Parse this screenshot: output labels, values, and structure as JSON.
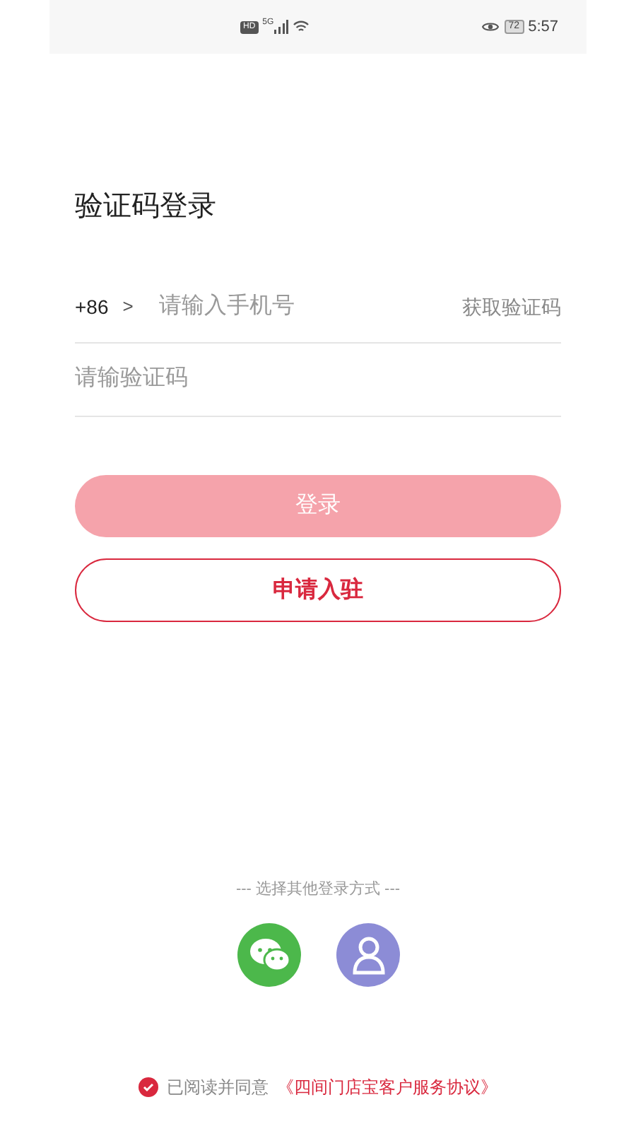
{
  "status_bar": {
    "hd": "HD",
    "network": "5G",
    "battery": "72",
    "time": "5:57"
  },
  "title": "验证码登录",
  "phone": {
    "country_code": "+86",
    "arrow": ">",
    "placeholder": "请输入手机号",
    "get_code": "获取验证码"
  },
  "code": {
    "placeholder": "请输验证码"
  },
  "login_button": {
    "label": "登录",
    "disabled": true
  },
  "apply_button": {
    "label": "申请入驻"
  },
  "other_login": {
    "label": "--- 选择其他登录方式 ---",
    "options": [
      {
        "kind": "wechat",
        "color": "#4cb84b"
      },
      {
        "kind": "account",
        "color": "#8c8cd6"
      }
    ]
  },
  "agreement": {
    "checked": true,
    "text": "已阅读并同意",
    "link": "《四间门店宝客户服务协议》"
  }
}
